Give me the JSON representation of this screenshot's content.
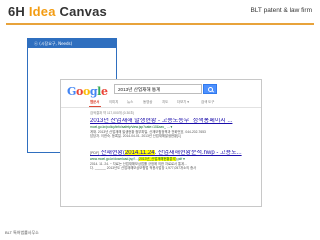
{
  "slide": {
    "title_prefix": "6H ",
    "title_highlight": "Idea",
    "title_suffix": " Canvas",
    "brand": "BLT patent & law firm",
    "needs_header": "ⓔ (시장요구, Needs)",
    "footer": "BLT 특허법률사무소"
  },
  "browser": {
    "logo": [
      "G",
      "o",
      "o",
      "g",
      "l",
      "e"
    ],
    "logo_colors": [
      "#4285f4",
      "#ea4335",
      "#fbbc05",
      "#4285f4",
      "#34a853",
      "#ea4335"
    ],
    "query": "2013년 산업재해 통계",
    "tabs": [
      "웹문서",
      "이미지",
      "뉴스",
      "동영상",
      "지도",
      "더보기 ▾",
      "검색 도구"
    ],
    "active_tab": "웹문서",
    "result_stats": "검색결과 약 117,000개 (0.30초)",
    "results": [
      {
        "title": "2013년 산업재해 발생현황 - 고용노동부_정책홍페이지 ...",
        "url": "moel.go.kr/policy/info/safety/view.jsp?cate=10&sec_ ... ▾",
        "snippet": [
          "게재. 2013년 산업재해 발생현황 첨부파일. 산재보험정책과 전화번호. 044-202-7653",
          "담당자. 이한숙. 등록일. 2014-04-01. 2013년 산업재해발생현황[1]"
        ]
      },
      {
        "filetype": "[PDF]",
        "title_pre": "산재현황(",
        "title_hl": "2014.11.24",
        "title_post": ". 산업재해현황분석.hwp - 고용노...",
        "url_pre": "www.moel.go.kr/download.jsp?...(",
        "url_hl": "2013년_산업재해현황분석",
        "url_post": ").pdf ▾",
        "snippet": [
          "2014. 11. 24. ~ 자료는 산업재해보상법률 규정에 의한 자료로서 통계...",
          "다.   ______  2013년도 산업재해보상보험법 적용사업장 1,977,057개소의 종사"
        ]
      }
    ]
  }
}
